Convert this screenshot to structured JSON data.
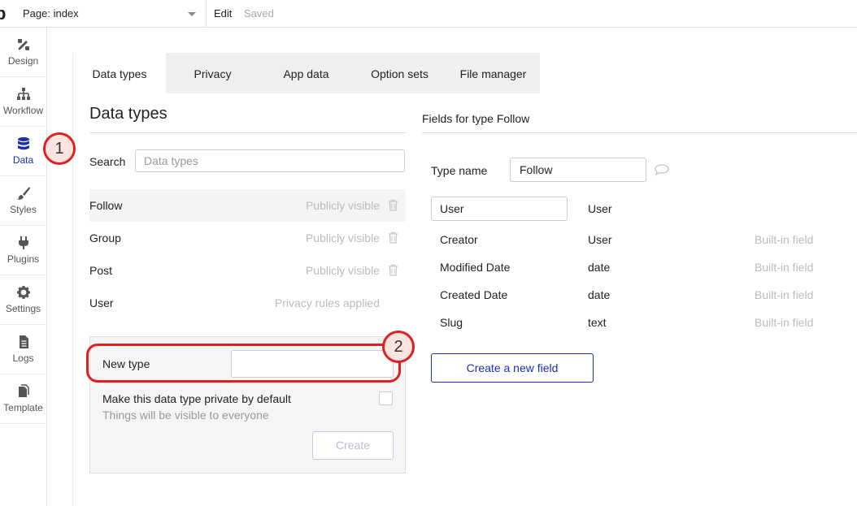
{
  "topbar": {
    "logo": "b",
    "page_label": "Page: index",
    "edit": "Edit",
    "saved": "Saved"
  },
  "sidebar": [
    {
      "label": "Design",
      "icon": "design-pencil-icon"
    },
    {
      "label": "Workflow",
      "icon": "workflow-icon"
    },
    {
      "label": "Data",
      "icon": "database-icon",
      "active": true
    },
    {
      "label": "Styles",
      "icon": "brush-icon"
    },
    {
      "label": "Plugins",
      "icon": "plug-icon"
    },
    {
      "label": "Settings",
      "icon": "gear-icon"
    },
    {
      "label": "Logs",
      "icon": "document-icon"
    },
    {
      "label": "Template",
      "icon": "template-icon"
    }
  ],
  "tabs": [
    "Data types",
    "Privacy",
    "App data",
    "Option sets",
    "File manager"
  ],
  "left": {
    "heading": "Data types",
    "search_label": "Search",
    "search_placeholder": "Data types",
    "types": [
      {
        "name": "Follow",
        "visibility": "Publicly visible"
      },
      {
        "name": "Group",
        "visibility": "Publicly visible"
      },
      {
        "name": "Post",
        "visibility": "Publicly visible"
      },
      {
        "name": "User",
        "visibility": "Privacy rules applied"
      }
    ],
    "new_type_label": "New type",
    "private_label": "Make this data type private by default",
    "private_sub": "Things will be visible to everyone",
    "create_button": "Create"
  },
  "right": {
    "heading": "Fields for type Follow",
    "type_name_label": "Type name",
    "type_name_value": "Follow",
    "user_field": {
      "name": "User",
      "type": "User"
    },
    "fields": [
      {
        "name": "Creator",
        "type": "User",
        "note": "Built-in field"
      },
      {
        "name": "Modified Date",
        "type": "date",
        "note": "Built-in field"
      },
      {
        "name": "Created Date",
        "type": "date",
        "note": "Built-in field"
      },
      {
        "name": "Slug",
        "type": "text",
        "note": "Built-in field"
      }
    ],
    "new_field_button": "Create a new field"
  },
  "callouts": [
    "1",
    "2"
  ],
  "colors": {
    "accent": "#1a2fb3",
    "callout": "#e02020"
  }
}
